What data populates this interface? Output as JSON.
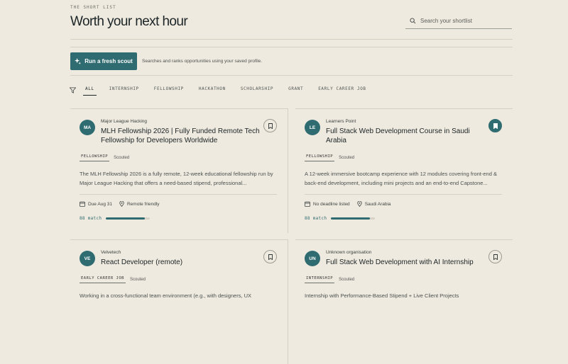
{
  "header": {
    "eyebrow": "THE SHORT LIST",
    "title": "Worth your next hour",
    "search_placeholder": "Search your shortlist"
  },
  "scout": {
    "button_label": "Run a fresh scout",
    "note": "Searches and ranks opportunities using your saved profile."
  },
  "filters": [
    "ALL",
    "INTERNSHIP",
    "FELLOWSHIP",
    "HACKATHON",
    "SCHOLARSHIP",
    "GRANT",
    "EARLY CAREER JOB"
  ],
  "active_filter": "ALL",
  "cards": [
    {
      "initials": "MA",
      "org": "Major League Hacking",
      "title": "MLH Fellowship 2026 | Fully Funded Remote Tech Fellowship for Developers Worldwide",
      "type": "FELLOWSHIP",
      "status": "Scouted",
      "description": "The MLH Fellowship 2026 is a fully remote, 12-week educational fellowship run by Major League Hacking that offers a need-based stipend, professional...",
      "deadline": "Due Aug 31",
      "location": "Remote friendly",
      "match_label": "88 match",
      "match": 88,
      "saved": false
    },
    {
      "initials": "LE",
      "org": "Learners Point",
      "title": "Full Stack Web Development Course in Saudi Arabia",
      "type": "FELLOWSHIP",
      "status": "Scouted",
      "description": "A 12-week immersive bootcamp experience with 12 modules covering front-end & back-end development, including mini projects and an end-to-end Capstone...",
      "deadline": "No deadline listed",
      "location": "Saudi Arabia",
      "match_label": "88 match",
      "match": 88,
      "saved": true
    },
    {
      "initials": "VE",
      "org": "Velvetech",
      "title": "React Developer (remote)",
      "type": "EARLY CAREER JOB",
      "status": "Scouted",
      "description": "Working in a cross-functional team environment (e.g., with designers, UX",
      "saved": false
    },
    {
      "initials": "UN",
      "org": "Unknown organisation",
      "title": "Full Stack Web Development with AI Internship",
      "type": "INTERNSHIP",
      "status": "Scouted",
      "description": "Internship with Performance-Based Stipend + Live Client Projects",
      "saved": false
    }
  ],
  "colors": {
    "accent": "#2f6c71",
    "background": "#efeadf"
  }
}
